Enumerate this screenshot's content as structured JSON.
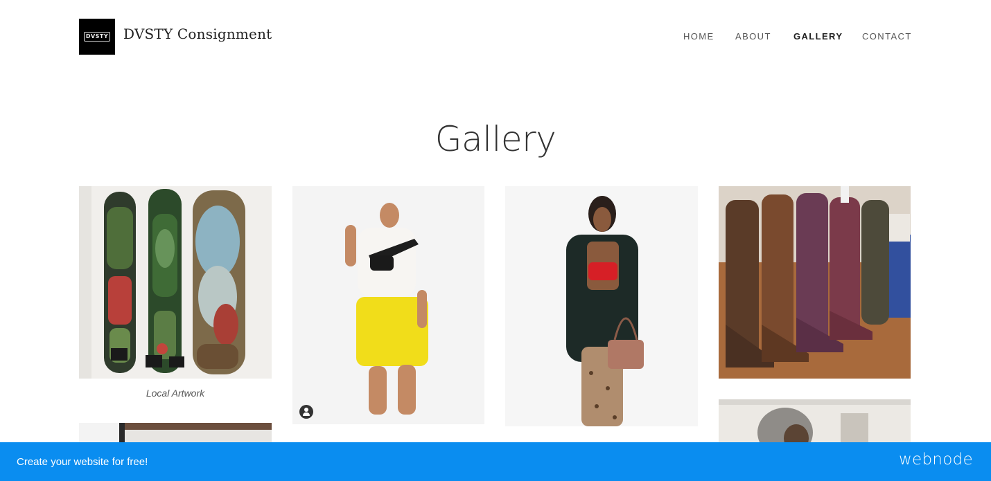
{
  "header": {
    "logo_text": "DVSTY",
    "site_title": "DVSTY Consignment",
    "nav": [
      {
        "label": "HOME"
      },
      {
        "label": "ABOUT"
      },
      {
        "label": "GALLERY"
      },
      {
        "label": "CONTACT"
      }
    ]
  },
  "main": {
    "title": "Gallery",
    "gallery": {
      "tiles": [
        {
          "image": "skateboard-decks-artwork",
          "caption": "Local Artwork"
        },
        {
          "image": "man-yellow-shorts-fanny-pack"
        },
        {
          "image": "woman-leopard-pants-handbag"
        },
        {
          "image": "cowboy-boots-row"
        },
        {
          "image": "interior-wall-photo"
        },
        {
          "image": "man-grey-hoodie-photo"
        }
      ]
    }
  },
  "promo_bar": {
    "text": "Create your website for free!",
    "brand": "webnode"
  },
  "colors": {
    "promo_bar": "#0a8df0",
    "active_nav": "#222222"
  }
}
